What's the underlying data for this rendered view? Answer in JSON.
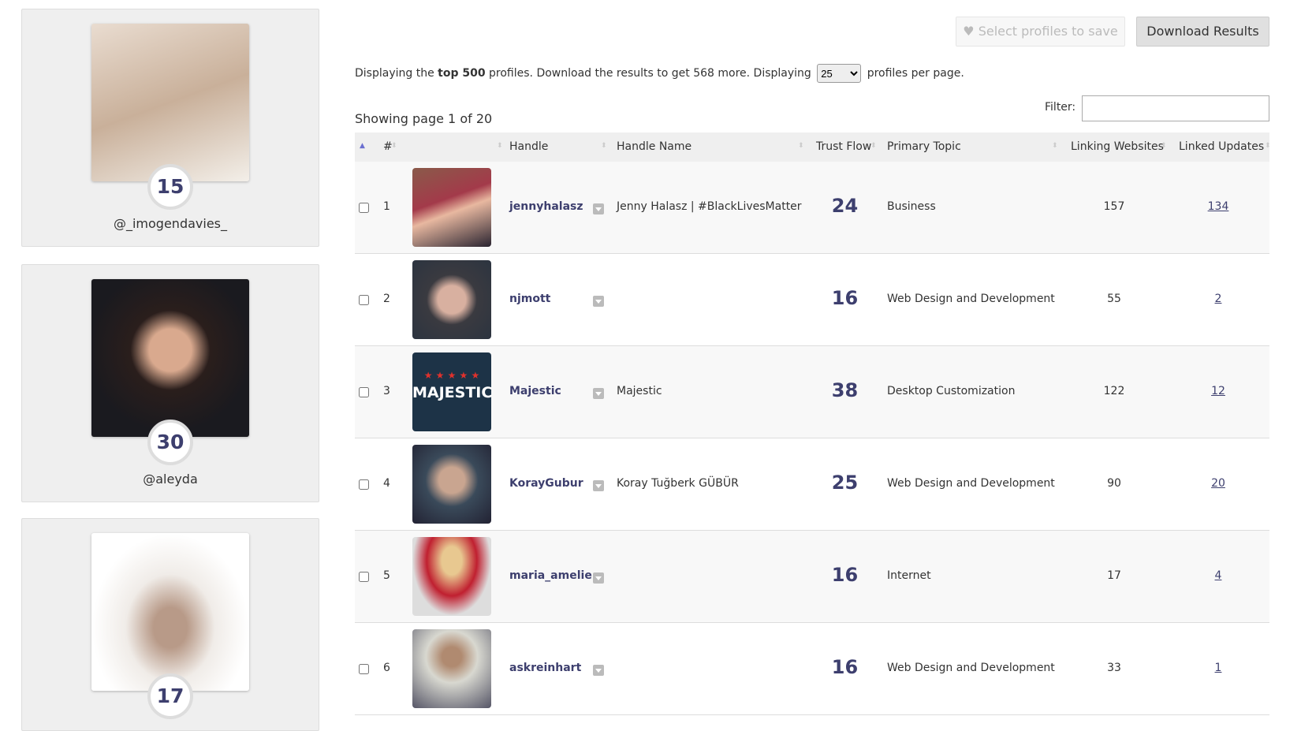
{
  "featured": [
    {
      "score": "15",
      "handle": "@_imogendavies_"
    },
    {
      "score": "30",
      "handle": "@aleyda"
    },
    {
      "score": "17",
      "handle": ""
    }
  ],
  "toolbar": {
    "select_label": "Select profiles to save",
    "download_label": "Download Results",
    "heart_icon": "heart-icon"
  },
  "info": {
    "pre": "Displaying the ",
    "bold": "top 500",
    "mid": " profiles. Download the results to get 568 more. Displaying ",
    "per_page": "25",
    "post": " profiles per page."
  },
  "filter": {
    "label": "Filter:",
    "value": ""
  },
  "showing": "Showing page 1 of 20",
  "columns": {
    "num": "#",
    "handle": "Handle",
    "handle_name": "Handle Name",
    "trust_flow": "Trust Flow",
    "topic": "Primary Topic",
    "linking": "Linking Websites",
    "linked": "Linked Updates"
  },
  "rows": [
    {
      "n": "1",
      "handle": "jennyhalasz",
      "name": "Jenny Halasz | #BlackLivesMatter",
      "tf": "24",
      "topic": "Business",
      "lw": "157",
      "lu": "134"
    },
    {
      "n": "2",
      "handle": "njmott",
      "name": "",
      "tf": "16",
      "topic": "Web Design and Development",
      "lw": "55",
      "lu": "2"
    },
    {
      "n": "3",
      "handle": "Majestic",
      "name": "Majestic",
      "tf": "38",
      "topic": "Desktop Customization",
      "lw": "122",
      "lu": "12",
      "logo": "MAJESTIC"
    },
    {
      "n": "4",
      "handle": "KorayGubur",
      "name": "Koray Tuğberk GÜBÜR",
      "tf": "25",
      "topic": "Web Design and Development",
      "lw": "90",
      "lu": "20"
    },
    {
      "n": "5",
      "handle": "maria_amelie",
      "name": "",
      "tf": "16",
      "topic": "Internet",
      "lw": "17",
      "lu": "4"
    },
    {
      "n": "6",
      "handle": "askreinhart",
      "name": "",
      "tf": "16",
      "topic": "Web Design and Development",
      "lw": "33",
      "lu": "1"
    }
  ],
  "colors": {
    "accent": "#3d3f6e",
    "header_bg": "#efefef",
    "card_bg": "#efefef"
  }
}
